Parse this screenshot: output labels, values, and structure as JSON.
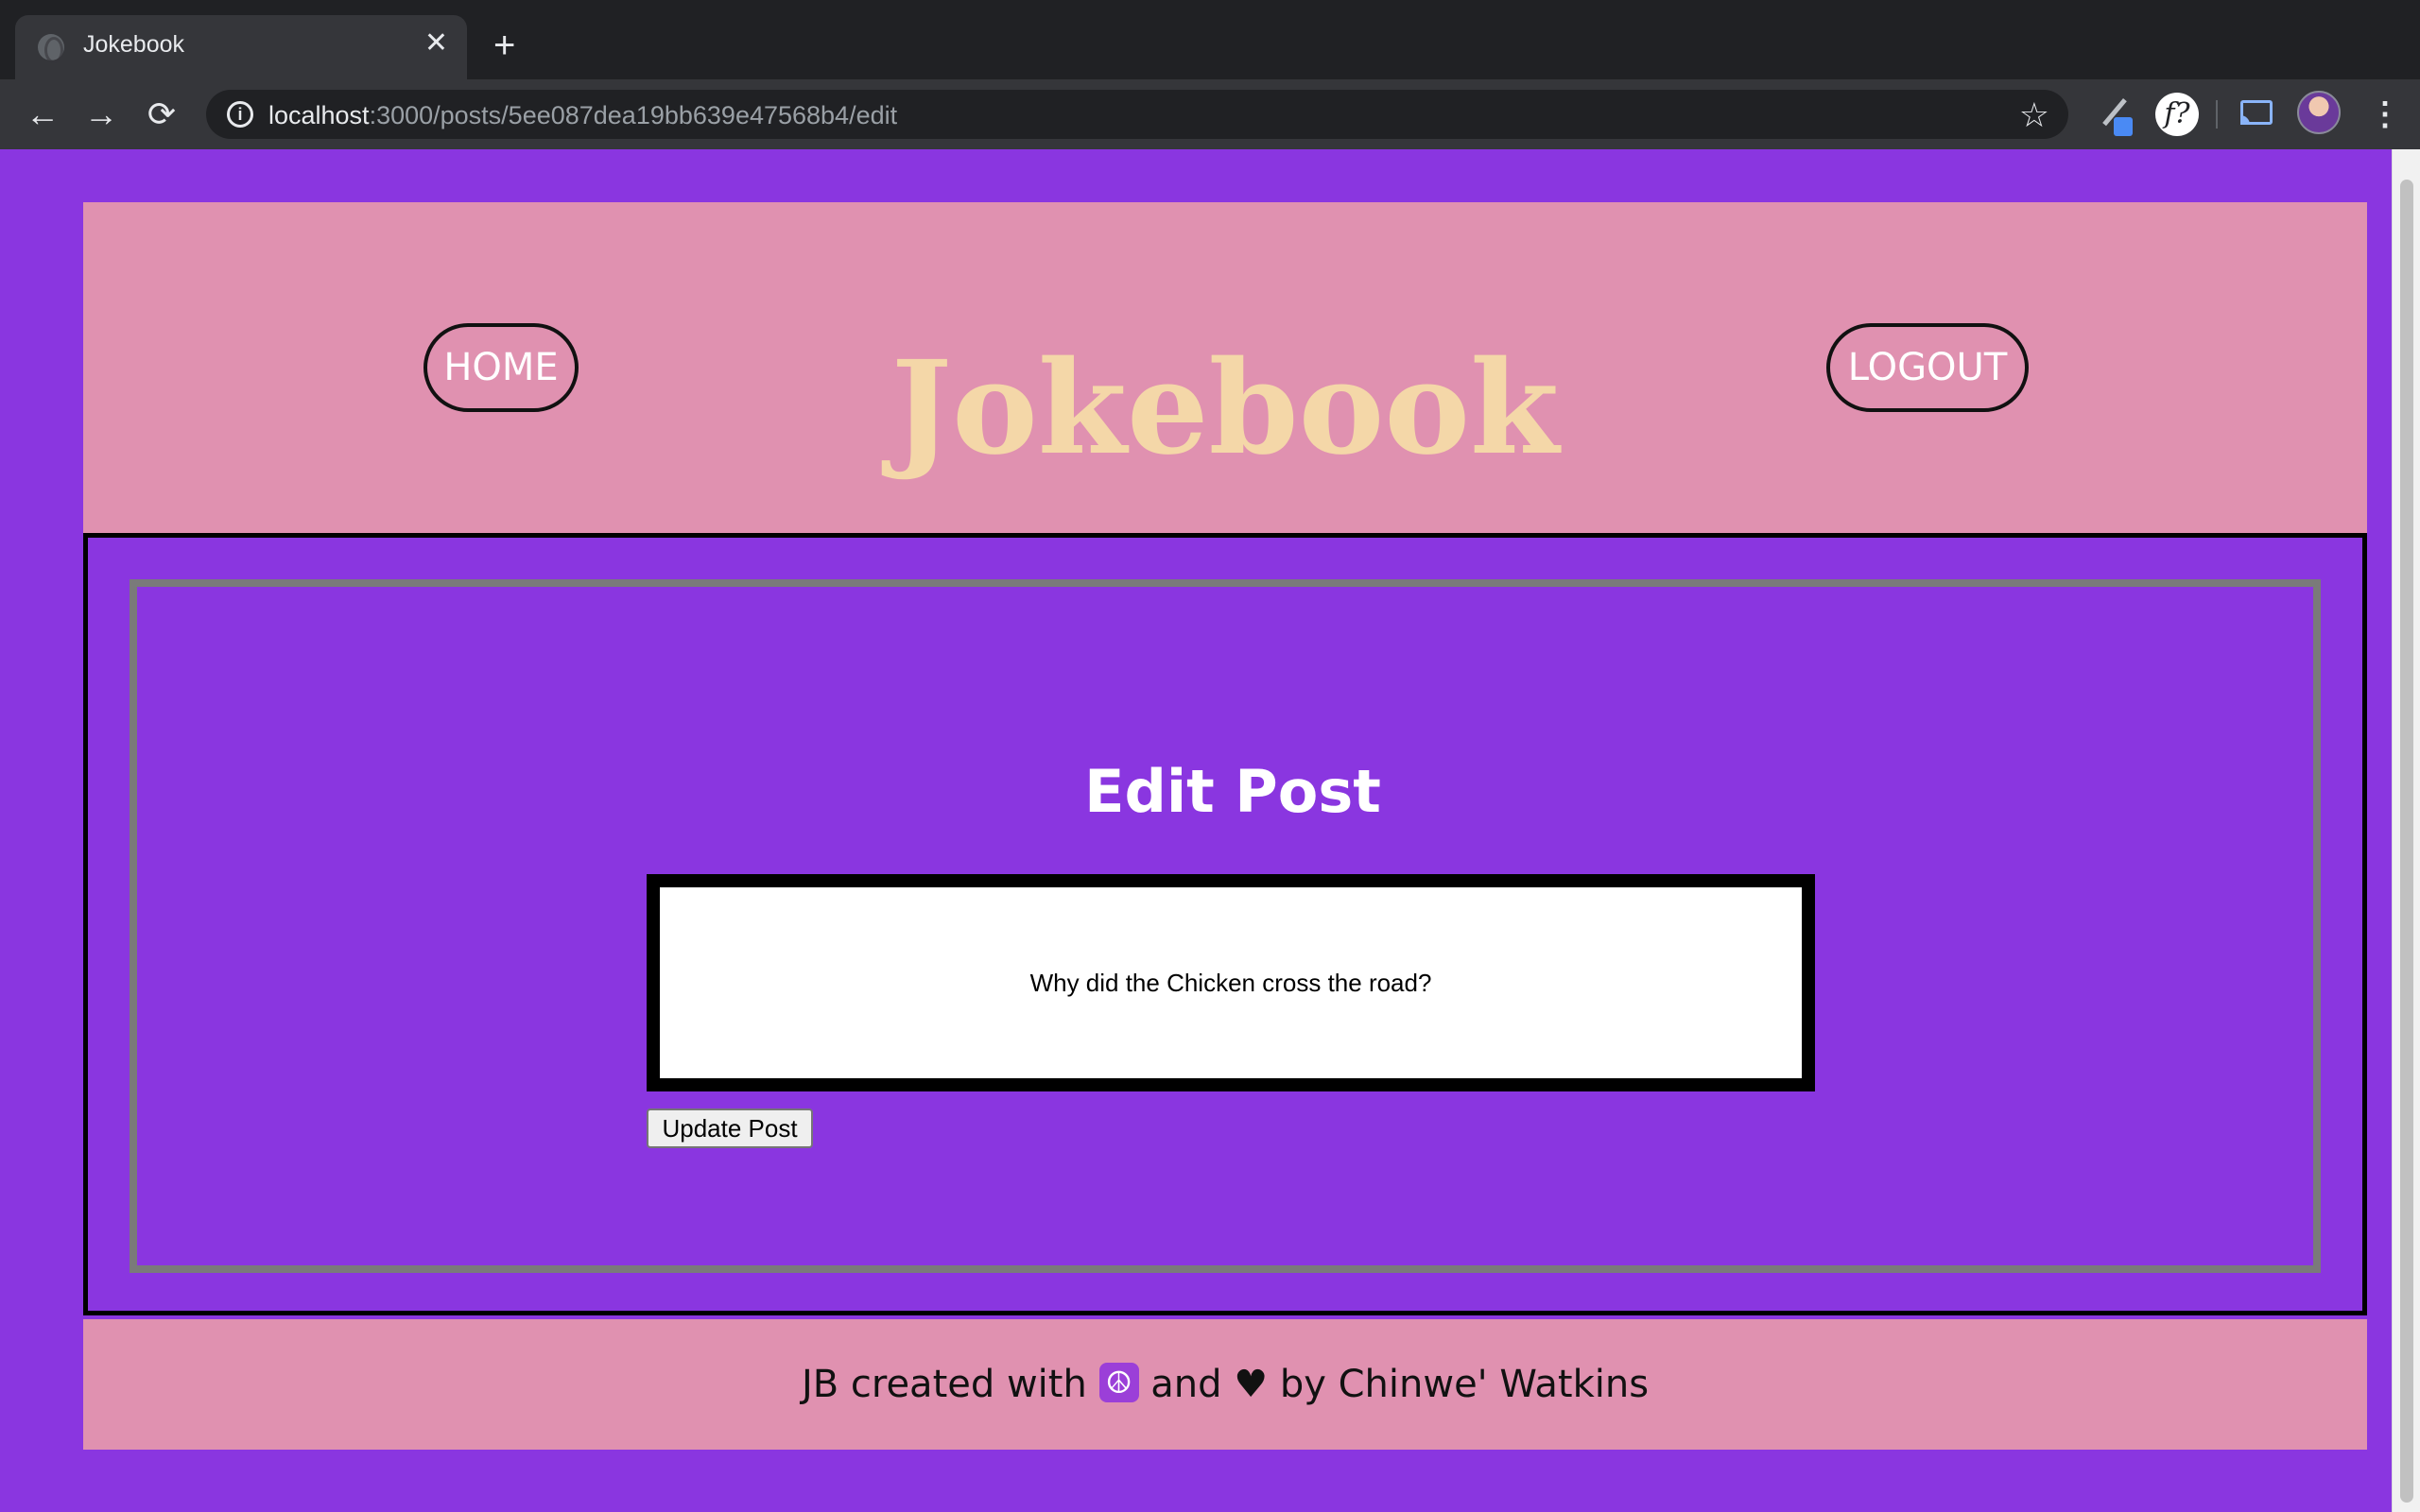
{
  "browser": {
    "tab_title": "Jokebook",
    "tab_close": "✕",
    "new_tab": "+",
    "back": "←",
    "forward": "→",
    "reload": "⟳",
    "url_host": "localhost",
    "url_path": ":3000/posts/5ee087dea19bb639e47568b4/edit",
    "info": "i",
    "bookmark": "☆",
    "extension_f": "f?",
    "menu": "⋮"
  },
  "header": {
    "home_label": "HOME",
    "logo": "Jokebook",
    "logout_label": "LOGOUT"
  },
  "main": {
    "title": "Edit Post",
    "post_value": "Why did the Chicken cross the road?",
    "update_label": "Update Post"
  },
  "footer": {
    "prefix": "JB created with",
    "peace": "☮",
    "middle": "and ♥ by Chinwe' Watkins"
  },
  "colors": {
    "page_bg": "#8a36e0",
    "header_bg": "#e091b0",
    "logo": "#f4d7a8",
    "frame": "#7a7a7a"
  }
}
